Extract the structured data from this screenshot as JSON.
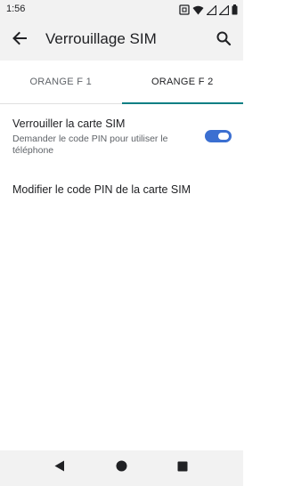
{
  "status_bar": {
    "time": "1:56",
    "icons": [
      "nfc-icon",
      "wifi-icon",
      "signal-icon",
      "signal-icon",
      "battery-icon"
    ]
  },
  "app_bar": {
    "title": "Verrouillage SIM",
    "back_icon": "arrow-back-icon",
    "search_icon": "search-icon"
  },
  "tabs": [
    {
      "label": "ORANGE F 1",
      "selected": false
    },
    {
      "label": "ORANGE F 2",
      "selected": true
    }
  ],
  "settings": {
    "lock_sim": {
      "title": "Verrouiller la carte SIM",
      "summary": "Demander le code PIN pour utiliser le téléphone",
      "enabled": true
    },
    "change_pin": {
      "title": "Modifier le code PIN de la carte SIM"
    }
  },
  "nav_bar": {
    "icons": [
      "nav-back-icon",
      "nav-home-icon",
      "nav-recents-icon"
    ]
  },
  "colors": {
    "accent": "#0a7f84",
    "toggle": "#3b6fd1",
    "bars": "#f2f2f2"
  }
}
